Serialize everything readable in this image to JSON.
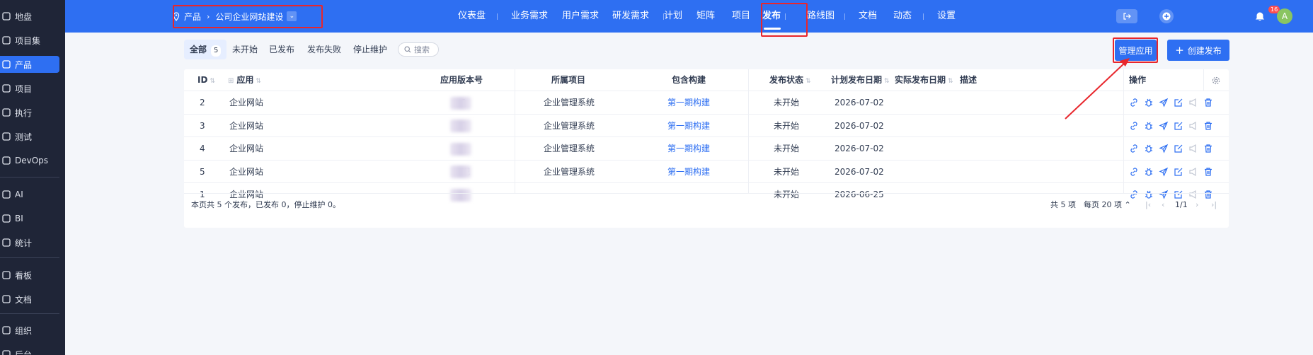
{
  "sidebar": {
    "items": [
      {
        "label": "地盘",
        "icon": "home-icon"
      },
      {
        "label": "项目集",
        "icon": "grid-icon"
      },
      {
        "label": "产品",
        "icon": "product-pin-icon",
        "active": true
      },
      {
        "label": "项目",
        "icon": "rocket-icon"
      },
      {
        "label": "执行",
        "icon": "run-icon"
      },
      {
        "label": "测试",
        "icon": "test-icon"
      },
      {
        "label": "DevOps",
        "icon": "infinity-icon"
      },
      {
        "label": "AI",
        "icon": "robot-icon"
      },
      {
        "label": "BI",
        "icon": "chart-icon"
      },
      {
        "label": "统计",
        "icon": "bar-chart-icon"
      },
      {
        "label": "看板",
        "icon": "kanban-icon"
      },
      {
        "label": "文档",
        "icon": "doc-icon"
      },
      {
        "label": "组织",
        "icon": "org-icon"
      },
      {
        "label": "后台",
        "icon": "admin-icon"
      }
    ]
  },
  "header": {
    "breadcrumb": {
      "product": "产品",
      "project": "公司企业网站建设"
    },
    "nav": [
      "仪表盘",
      "业务需求",
      "用户需求",
      "研发需求",
      "计划",
      "矩阵",
      "项目",
      "发布",
      "路线图",
      "文档",
      "动态",
      "设置"
    ],
    "active_nav": "发布",
    "notification_count": "16",
    "avatar_letter": "A"
  },
  "toolbar": {
    "tabs": [
      {
        "label": "全部",
        "count": "5"
      },
      {
        "label": "未开始"
      },
      {
        "label": "已发布"
      },
      {
        "label": "发布失败"
      },
      {
        "label": "停止维护"
      }
    ],
    "search_label": "搜索",
    "manage_app_label": "管理应用",
    "create_release_label": "创建发布"
  },
  "table": {
    "columns": {
      "id": "ID",
      "app": "应用",
      "version": "应用版本号",
      "project": "所属项目",
      "builds": "包含构建",
      "status": "发布状态",
      "plan_date": "计划发布日期",
      "actual_date": "实际发布日期",
      "desc": "描述",
      "actions": "操作"
    },
    "rows": [
      {
        "id": "2",
        "app": "企业网站",
        "version": "1",
        "project": "企业管理系统",
        "builds": "第一期构建",
        "status": "未开始",
        "plan_date": "2026-07-02"
      },
      {
        "id": "3",
        "app": "企业网站",
        "version": "2",
        "project": "企业管理系统",
        "builds": "第一期构建",
        "status": "未开始",
        "plan_date": "2026-07-02"
      },
      {
        "id": "4",
        "app": "企业网站",
        "version": "",
        "project": "企业管理系统",
        "builds": "第一期构建",
        "status": "未开始",
        "plan_date": "2026-07-02"
      },
      {
        "id": "5",
        "app": "企业网站",
        "version": "吧",
        "project": "企业管理系统",
        "builds": "第一期构建",
        "status": "未开始",
        "plan_date": "2026-07-02"
      },
      {
        "id": "1",
        "app": "企业网站",
        "version": "v",
        "project": "",
        "builds": "",
        "status": "未开始",
        "plan_date": "2026-06-25"
      }
    ],
    "row_action_icons": [
      "link-icon",
      "bug-icon",
      "send-icon",
      "edit-icon",
      "notice-icon",
      "trash-icon"
    ],
    "footer": {
      "summary": "本页共 5 个发布，已发布 0，停止维护 0。",
      "total": "共 5 项",
      "per_page": "每页 20 项",
      "page": "1/1"
    }
  },
  "colors": {
    "primary": "#2e6ff2",
    "sidebar": "#1f2537",
    "annotation": "#e8262c"
  }
}
